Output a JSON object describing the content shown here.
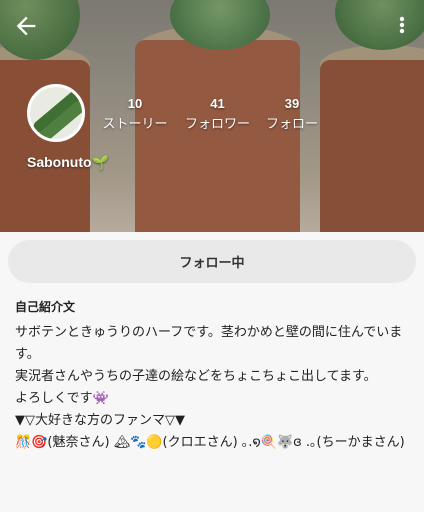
{
  "header": {
    "back_icon": "arrow-left-icon",
    "more_icon": "more-vertical-icon"
  },
  "profile": {
    "username": "Sabonuto🌱",
    "stats": {
      "stories": {
        "count": "10",
        "label": "ストーリー"
      },
      "followers": {
        "count": "41",
        "label": "フォロワー"
      },
      "following": {
        "count": "39",
        "label": "フォロー"
      }
    }
  },
  "actions": {
    "follow_label": "フォロー中"
  },
  "bio": {
    "title": "自己紹介文",
    "lines": [
      "サボテンときゅうりのハーフです。茎わかめと壁の間に住んでいます。",
      "実況者さんやうちの子達の絵などをちょこちょこ出してます。",
      "よろしくです👾",
      "",
      "▼▽大好きな方のファンマ▽▼",
      "🎊🎯(魅奈さん) 🏔🐾🟡(クロエさん) ｡.໑🍭🐺ɞ .｡(ちーかまさん)"
    ]
  },
  "colors": {
    "button_bg": "#e9e9e9",
    "page_bg": "#f7f7f7"
  }
}
